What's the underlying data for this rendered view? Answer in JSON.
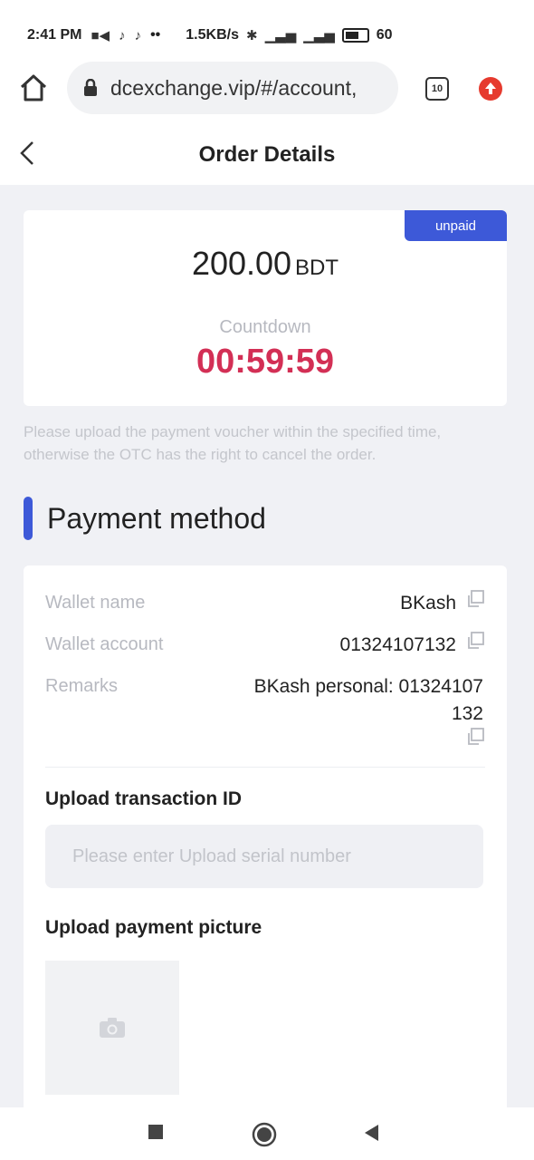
{
  "status_bar": {
    "time": "2:41 PM",
    "dots": "••",
    "network_speed": "1.5KB/s",
    "battery": "60"
  },
  "browser": {
    "url": "dcexchange.vip/#/account,",
    "tab_count": "10"
  },
  "header": {
    "title": "Order Details"
  },
  "order": {
    "status_badge": "unpaid",
    "amount": "200.00",
    "currency": "BDT",
    "countdown_label": "Countdown",
    "countdown_value": "00:59:59"
  },
  "notice": "Please upload the payment voucher within the specified time, otherwise the OTC has the right to cancel the order.",
  "payment": {
    "section_title": "Payment method",
    "wallet_name_label": "Wallet name",
    "wallet_name_value": "BKash",
    "wallet_account_label": "Wallet account",
    "wallet_account_value": "01324107132",
    "remarks_label": "Remarks",
    "remarks_value_line1": "BKash personal: 01324107",
    "remarks_value_line2": "132",
    "upload_tx_title": "Upload transaction ID",
    "upload_tx_placeholder": "Please enter Upload serial number",
    "upload_picture_title": "Upload payment picture"
  },
  "colors": {
    "accent": "#3d59d8",
    "countdown": "#d32f55"
  }
}
